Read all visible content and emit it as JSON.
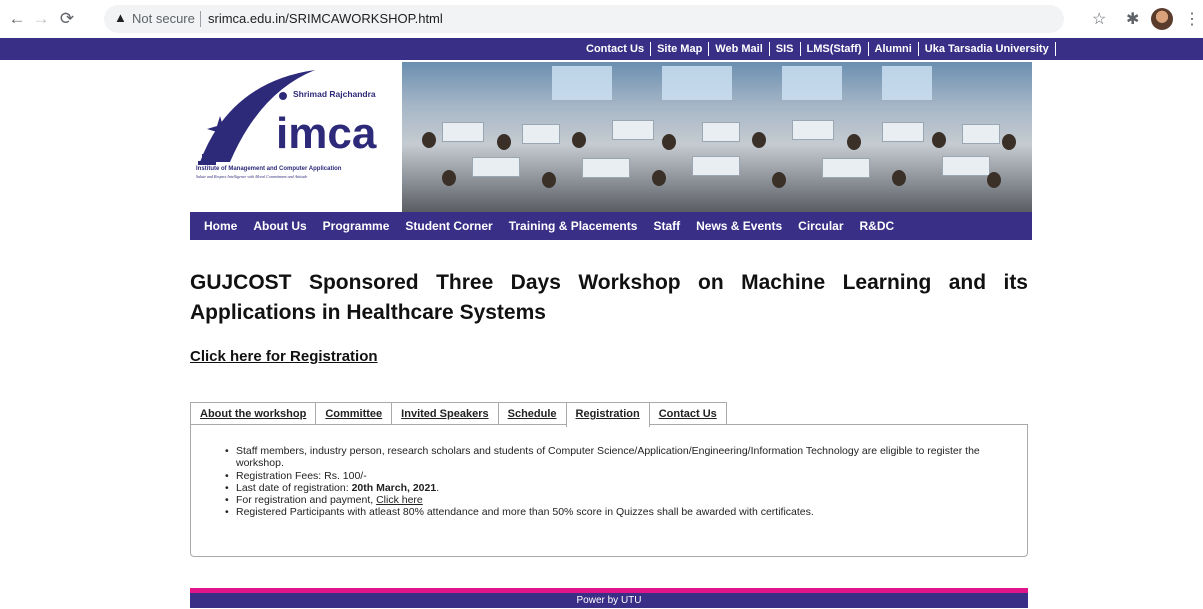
{
  "browser": {
    "security_label": "Not secure",
    "url": "srimca.edu.in/SRIMCAWORKSHOP.html"
  },
  "top_links": [
    "Contact Us",
    "Site Map",
    "Web Mail",
    "SIS",
    "LMS(Staff)",
    "Alumni",
    "Uka Tarsadia University"
  ],
  "logo": {
    "name_line": "Shrimad Rajchandra",
    "wordmark": "imca",
    "institute": "Institute of Management and Computer Application",
    "motto": "Salute and Respect Intelligence with Moral Commitment and Attitude"
  },
  "main_nav": [
    "Home",
    "About Us",
    "Programme",
    "Student Corner",
    "Training & Placements",
    "Staff",
    "News & Events",
    "Circular",
    "R&DC"
  ],
  "page_title": "GUJCOST Sponsored Three Days Workshop on Machine Learning and its Applications in Healthcare Systems",
  "registration_link": "Click here for Registration",
  "tabs": [
    "About the workshop",
    "Committee",
    "Invited Speakers",
    "Schedule",
    "Registration",
    "Contact Us"
  ],
  "active_tab": "Registration",
  "registration_info": {
    "eligibility": "Staff members, industry person, research scholars and students of Computer Science/Application/Engineering/Information Technology are eligible to register the workshop.",
    "fees": "Registration Fees: Rs. 100/-",
    "last_date_label": "Last date of registration: ",
    "last_date_value": "20th March, 2021",
    "last_date_suffix": ".",
    "payment_label": "For registration and payment, ",
    "payment_link": "Click here",
    "certificate_note": "Registered Participants with atleast 80% attendance and more than 50% score in Quizzes shall be awarded with certificates."
  },
  "footer": "Power by UTU",
  "colors": {
    "brand_purple": "#3a2f87",
    "accent_pink": "#e0158a"
  }
}
